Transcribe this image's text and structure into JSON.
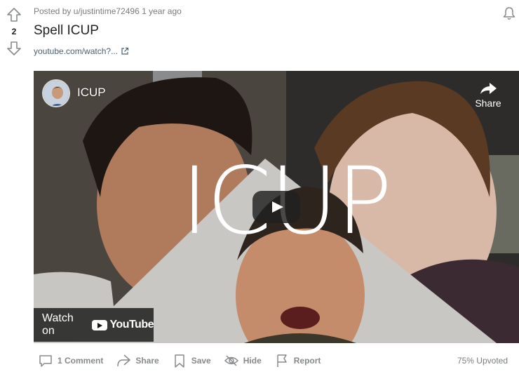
{
  "post": {
    "score": "2",
    "author_line": "Posted by u/justintime72496",
    "time": "1 year ago",
    "title": "Spell ICUP",
    "link": "youtube.com/watch?..."
  },
  "video": {
    "channel_name": "ICUP",
    "share_label": "Share",
    "overlay_title": "ICUP",
    "watch_on_label": "Watch on",
    "youtube_label": "YouTube"
  },
  "actions": {
    "comments": "1 Comment",
    "share": "Share",
    "save": "Save",
    "hide": "Hide",
    "report": "Report"
  },
  "upvote_ratio": "75% Upvoted",
  "colors": {
    "meta_text": "#787c7e",
    "action_text": "#878a8c",
    "link_text": "#4a5f6e"
  },
  "icons": [
    "arrow-up-icon",
    "arrow-down-icon",
    "bell-icon",
    "external-link-icon",
    "share-arrow-icon",
    "comment-icon",
    "share-icon",
    "bookmark-icon",
    "eye-slash-icon",
    "flag-icon",
    "play-icon",
    "youtube-logo-icon"
  ]
}
